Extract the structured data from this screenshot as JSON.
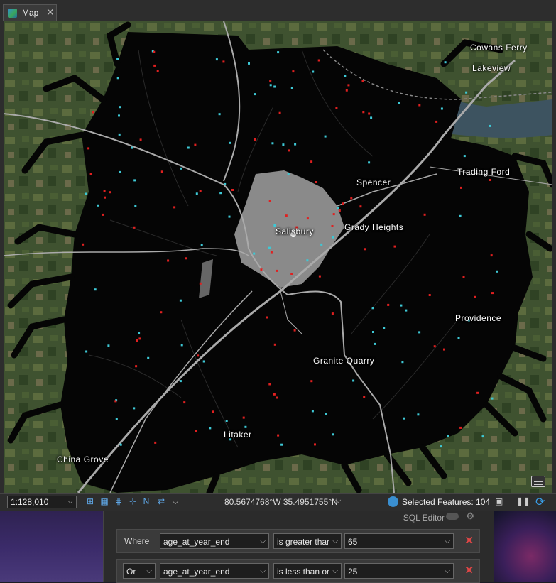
{
  "window": {
    "tab_label": "Map"
  },
  "map": {
    "places": [
      {
        "name": "Cowans Ferry"
      },
      {
        "name": "Lakeview"
      },
      {
        "name": "Trading Ford"
      },
      {
        "name": "Spencer"
      },
      {
        "name": "Salisbury"
      },
      {
        "name": "Grady Heights"
      },
      {
        "name": "Providence"
      },
      {
        "name": "Granite Quarry"
      },
      {
        "name": "Litaker"
      },
      {
        "name": "China Grove"
      }
    ],
    "point_colors": {
      "red": "#e02020",
      "cyan": "#3ec9d6"
    }
  },
  "status_bar": {
    "scale": "1:128,010",
    "coordinates": "80.5674768°W 35.4951755°N",
    "selected_features": "Selected Features: 104"
  },
  "query_panel": {
    "sql_editor_label": "SQL Editor",
    "rows": [
      {
        "connector": "Where",
        "field": "age_at_year_end",
        "operator": "is greater thar",
        "value": "65"
      },
      {
        "connector": "Or",
        "field": "age_at_year_end",
        "operator": "is less than or",
        "value": "25"
      }
    ]
  }
}
